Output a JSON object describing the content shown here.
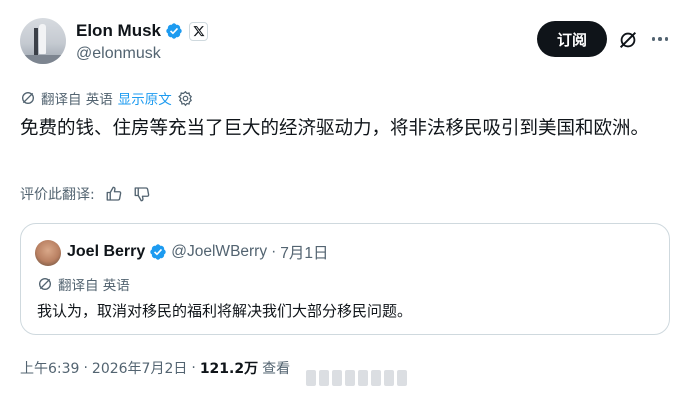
{
  "author": {
    "name": "Elon Musk",
    "handle": "@elonmusk"
  },
  "actions": {
    "subscribe_label": "订阅"
  },
  "translation": {
    "label": "翻译自 英语",
    "show_original": "显示原文"
  },
  "tweet": {
    "text": "免费的钱、住房等充当了巨大的经济驱动力，将非法移民吸引到美国和欧洲。"
  },
  "rate": {
    "label": "评价此翻译:"
  },
  "quote": {
    "name": "Joel Berry",
    "handle": "@JoelWBerry",
    "separator": "·",
    "date": "7月1日",
    "translation_label": "翻译自 英语",
    "text": "我认为，取消对移民的福利将解决我们大部分移民问题。"
  },
  "meta": {
    "time": "上午6:39",
    "separator": "·",
    "date": "2026年7月2日",
    "views_count": "121.2万",
    "views_label": "查看"
  },
  "colors": {
    "accent": "#1d9bf0",
    "text": "#0f1419",
    "muted": "#536471",
    "border": "#cfd9de"
  }
}
